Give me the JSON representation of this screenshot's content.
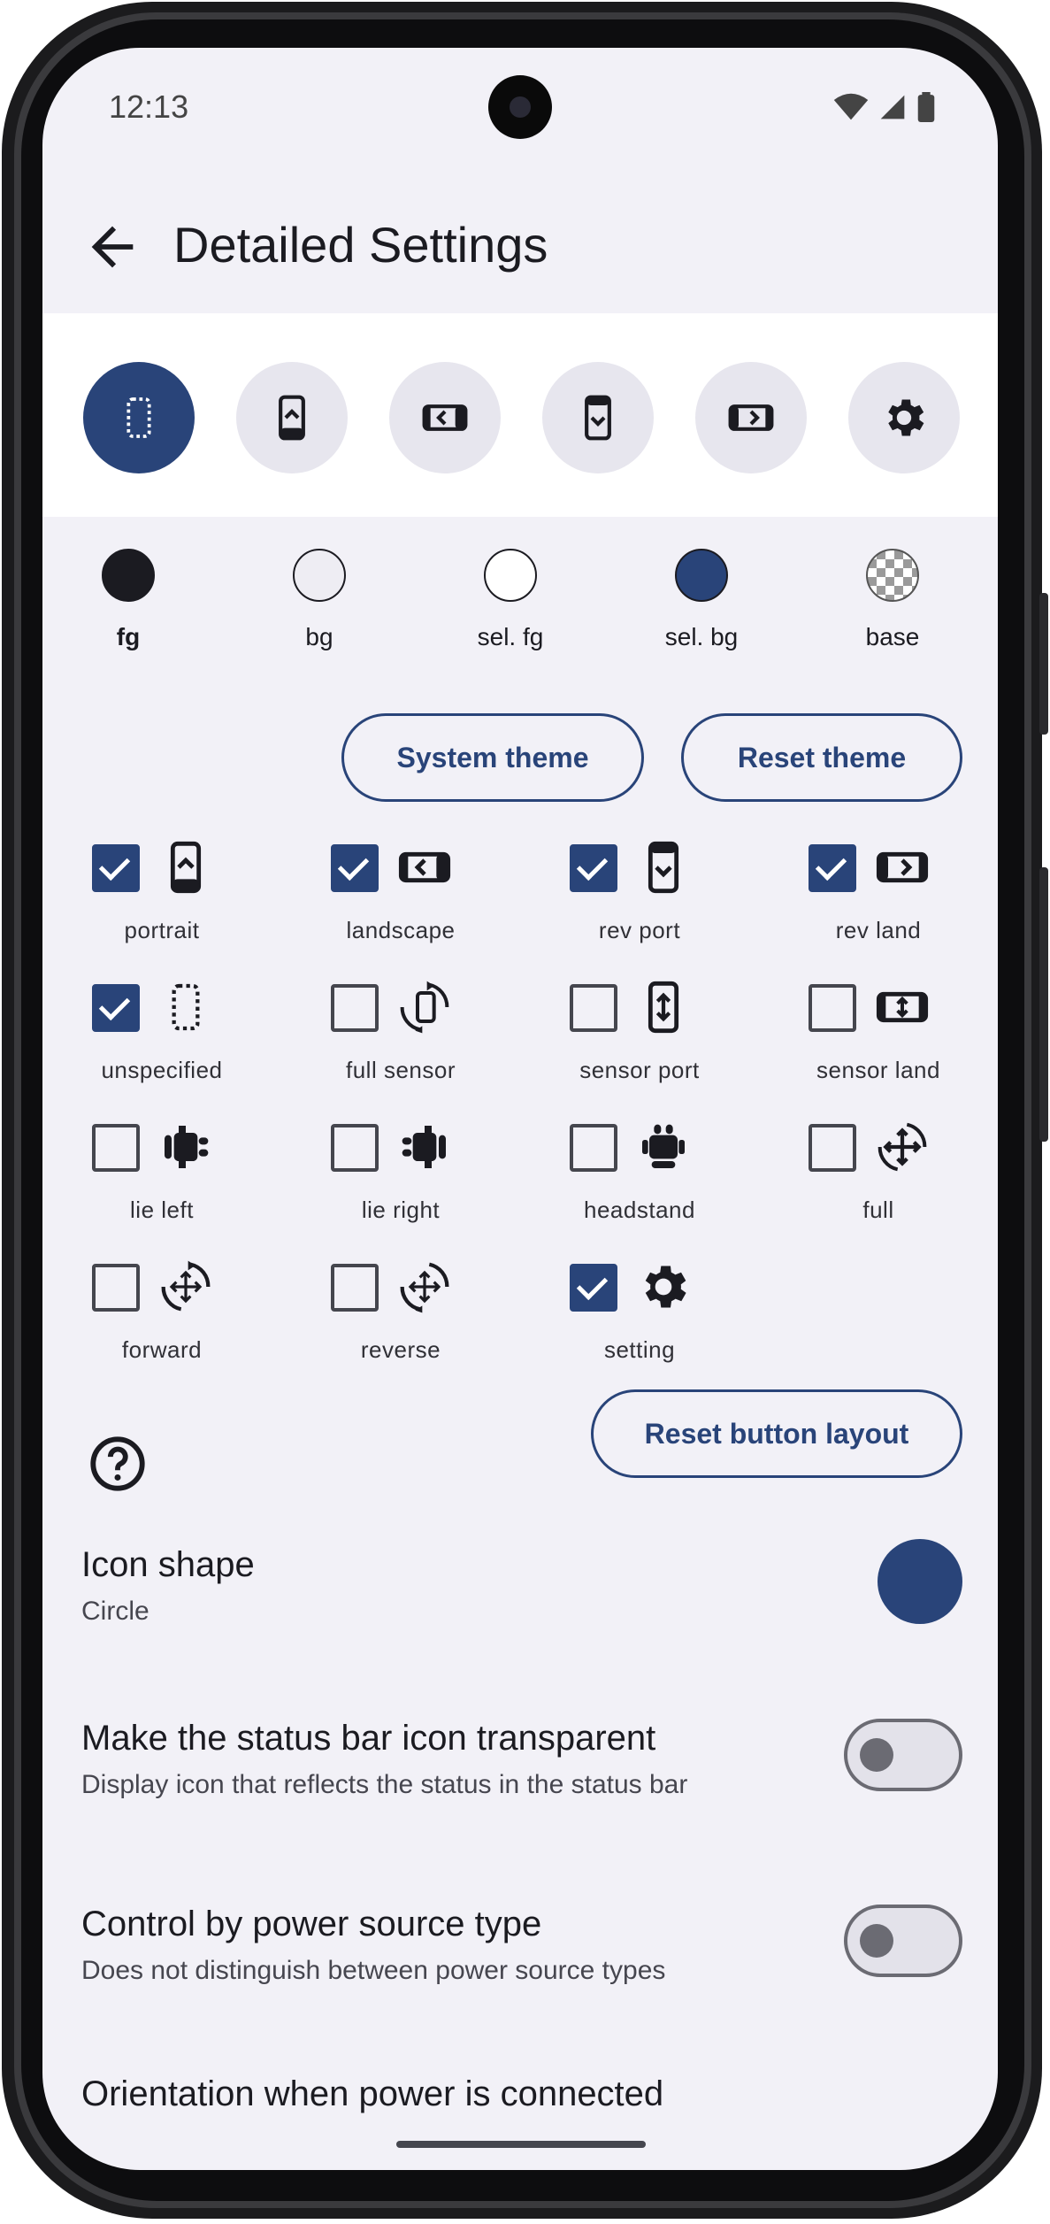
{
  "status_bar": {
    "time": "12:13"
  },
  "app_bar": {
    "title": "Detailed Settings"
  },
  "orientation_buttons": [
    {
      "name": "unspecified",
      "selected": true
    },
    {
      "name": "portrait",
      "selected": false
    },
    {
      "name": "landscape",
      "selected": false
    },
    {
      "name": "rev port",
      "selected": false
    },
    {
      "name": "rev land",
      "selected": false
    },
    {
      "name": "setting",
      "selected": false
    }
  ],
  "colors": [
    {
      "label": "fg",
      "color": "#1b1b21",
      "bold": true
    },
    {
      "label": "bg",
      "color": "#eeedf3",
      "bold": false
    },
    {
      "label": "sel. fg",
      "color": "#ffffff",
      "bold": false
    },
    {
      "label": "sel. bg",
      "color": "#294479",
      "bold": false
    },
    {
      "label": "base",
      "color": "checker",
      "bold": false
    }
  ],
  "buttons": {
    "system_theme": "System theme",
    "reset_theme": "Reset theme",
    "reset_layout": "Reset button layout"
  },
  "orientations": [
    {
      "label": "portrait",
      "checked": true,
      "icon": "portrait-icon"
    },
    {
      "label": "landscape",
      "checked": true,
      "icon": "landscape-icon"
    },
    {
      "label": "rev port",
      "checked": true,
      "icon": "reverse-portrait-icon"
    },
    {
      "label": "rev land",
      "checked": true,
      "icon": "reverse-landscape-icon"
    },
    {
      "label": "unspecified",
      "checked": true,
      "icon": "unspecified-icon"
    },
    {
      "label": "full sensor",
      "checked": false,
      "icon": "rotate-icon"
    },
    {
      "label": "sensor port",
      "checked": false,
      "icon": "sensor-portrait-icon"
    },
    {
      "label": "sensor land",
      "checked": false,
      "icon": "sensor-landscape-icon"
    },
    {
      "label": "lie left",
      "checked": false,
      "icon": "android-lie-left-icon"
    },
    {
      "label": "lie right",
      "checked": false,
      "icon": "android-lie-right-icon"
    },
    {
      "label": "headstand",
      "checked": false,
      "icon": "android-headstand-icon"
    },
    {
      "label": "full",
      "checked": false,
      "icon": "move-rotate-icon"
    },
    {
      "label": "forward",
      "checked": false,
      "icon": "move-rotate-forward-icon"
    },
    {
      "label": "reverse",
      "checked": false,
      "icon": "move-rotate-reverse-icon"
    },
    {
      "label": "setting",
      "checked": true,
      "icon": "gear-icon"
    }
  ],
  "prefs": {
    "icon_shape": {
      "title": "Icon shape",
      "value": "Circle"
    },
    "status_bar_transparent": {
      "title": "Make the status bar icon transparent",
      "summary": "Display icon that reflects the status in the status bar",
      "on": false
    },
    "power_source": {
      "title": "Control by power source type",
      "summary": "Does not distinguish between power source types",
      "on": false
    },
    "power_orientation": {
      "title": "Orientation when power is connected"
    }
  }
}
